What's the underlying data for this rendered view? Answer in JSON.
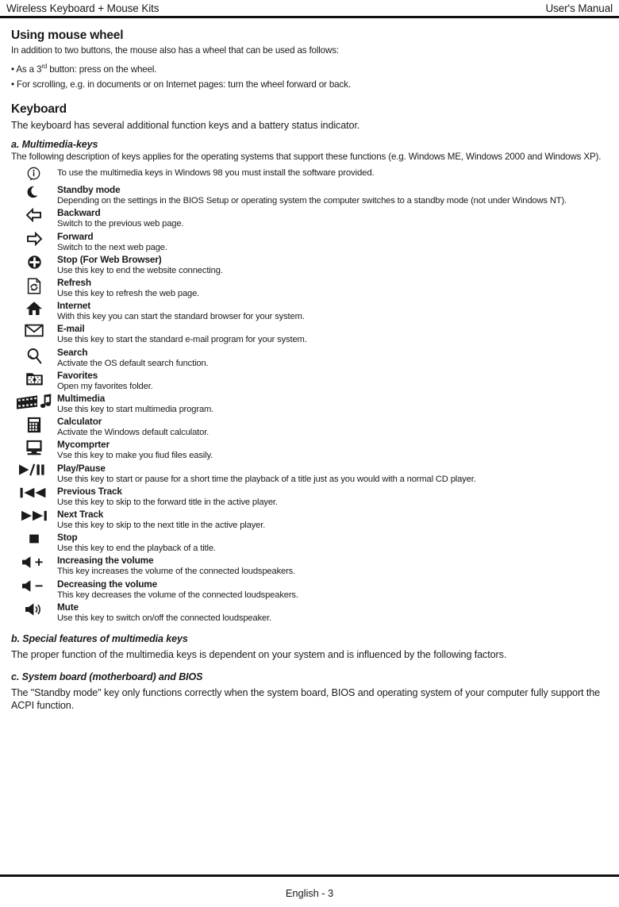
{
  "header": {
    "left_title": "Wireless Keyboard + Mouse Kits",
    "right_title": "User's Manual"
  },
  "mouse_wheel": {
    "heading": "Using mouse wheel",
    "intro": "In addition to two buttons, the mouse also has a wheel that can be used as follows:",
    "bullet1_prefix": "• As a 3",
    "bullet1_sup": "rd",
    "bullet1_suffix": " button: press on the wheel.",
    "bullet2": "• For scrolling, e.g. in documents or on Internet pages: turn the wheel forward or back."
  },
  "keyboard": {
    "heading": "Keyboard",
    "intro": "The keyboard has several additional function keys and a battery status indicator.",
    "subsection_a": "a. Multimedia-keys",
    "intro_a": "The following description of keys applies for the operating systems that support these functions (e.g. Windows ME, Windows 2000 and Windows XP).",
    "note": {
      "icon": "info-icon",
      "text": "To use the multimedia keys in Windows 98 you must install the software provided."
    },
    "keys": [
      {
        "icon": "moon-icon",
        "name": "Standby mode",
        "desc": "Depending on the settings in the BIOS Setup or operating system the computer switches to a standby mode (not under Windows NT)."
      },
      {
        "icon": "arrow-left-icon",
        "name": "Backward",
        "desc": "Switch to the previous web page."
      },
      {
        "icon": "arrow-right-icon",
        "name": "Forward",
        "desc": "Switch to the next web page."
      },
      {
        "icon": "stop-browser-icon",
        "name": "Stop (For Web Browser)",
        "desc": "Use this key to end the website connecting."
      },
      {
        "icon": "refresh-icon",
        "name": "Refresh",
        "desc": "Use this key to refresh the web page."
      },
      {
        "icon": "home-icon",
        "name": "Internet",
        "desc": "With this key you can start the standard browser for your system."
      },
      {
        "icon": "envelope-icon",
        "name": "E-mail",
        "desc": "Use this key to start the standard e-mail program for your system."
      },
      {
        "icon": "magnifier-icon",
        "name": "Search",
        "desc": "Activate the OS default search function."
      },
      {
        "icon": "favorites-folder-icon",
        "name": "Favorites",
        "desc": "Open my favorites folder."
      },
      {
        "icon": "filmstrip-music-icon",
        "name": "Multimedia",
        "desc": "Use this key to start multimedia program."
      },
      {
        "icon": "calculator-icon",
        "name": "Calculator",
        "desc": "Activate the Windows default calculator."
      },
      {
        "icon": "monitor-icon",
        "name": "Mycomprter",
        "desc": "Vse this key to make you fiud files easily."
      },
      {
        "icon": "play-pause-icon",
        "name": "Play/Pause",
        "desc": "Use this key to start or pause for a short time the playback of a title just as you would with a normal CD player."
      },
      {
        "icon": "previous-track-icon",
        "name": "Previous Track",
        "desc": "Use this key to skip to the forward title in the active player."
      },
      {
        "icon": "next-track-icon",
        "name": "Next Track",
        "desc": "Use this key to skip to the next title in the active player."
      },
      {
        "icon": "stop-square-icon",
        "name": "Stop",
        "desc": "Use this key to end the playback of a title."
      },
      {
        "icon": "volume-up-icon",
        "name": "Increasing the volume",
        "desc": "This key increases the volume of the connected loudspeakers."
      },
      {
        "icon": "volume-down-icon",
        "name": "Decreasing the volume",
        "desc": "This key decreases the volume of the connected loudspeakers."
      },
      {
        "icon": "mute-icon",
        "name": "Mute",
        "desc": "Use this key to switch on/off the connected loudspeaker."
      }
    ],
    "subsection_b": "b. Special features of multimedia keys",
    "intro_b": "The proper function of the multimedia keys is dependent on your system and is influenced by the following factors.",
    "subsection_c": "c. System board (motherboard) and BIOS",
    "intro_c": "The \"Standby mode\" key only functions correctly when the system board, BIOS and operating system of your computer fully support the ACPI function."
  },
  "footer": {
    "page_label": "English - 3"
  },
  "colors": {
    "ink": "#1a1a1a",
    "rule": "#111111",
    "paper": "#ffffff"
  }
}
